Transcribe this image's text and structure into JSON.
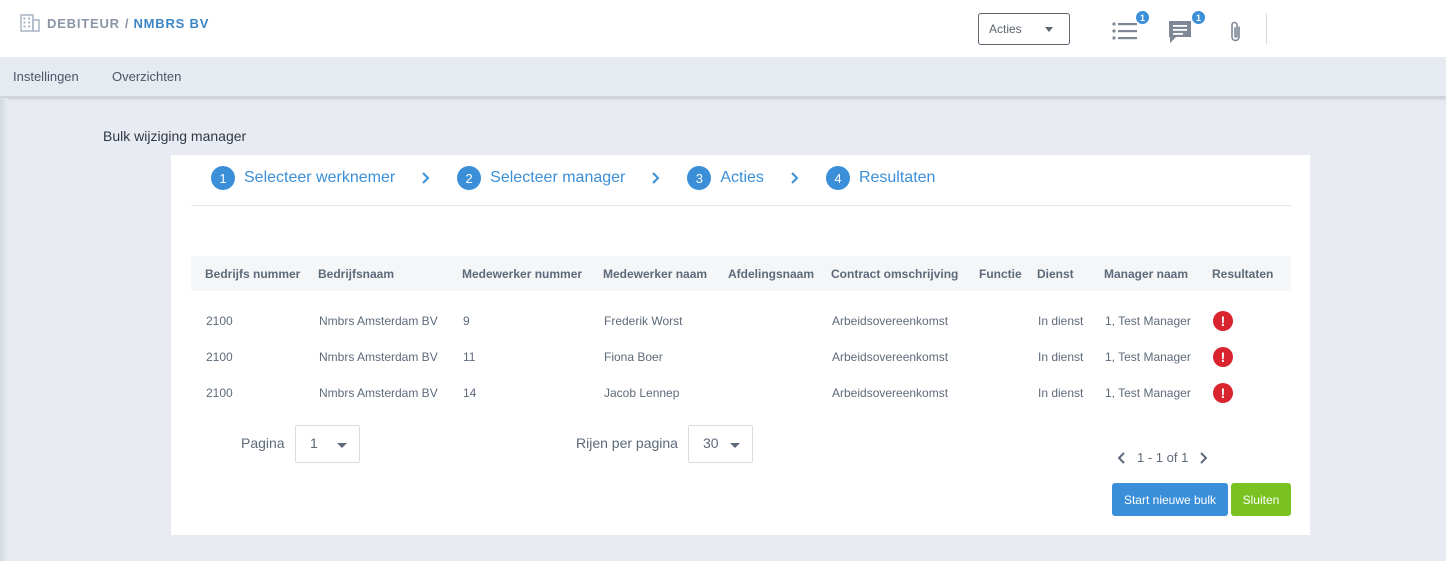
{
  "header": {
    "breadcrumb_root": "DEBITEUR",
    "breadcrumb_sep": "/",
    "breadcrumb_company": "NMBRS BV",
    "actions_dropdown": "Acties",
    "tasks_badge": "1",
    "messages_badge": "1"
  },
  "nav": {
    "items": [
      {
        "label": "Instellingen"
      },
      {
        "label": "Overzichten"
      }
    ]
  },
  "page": {
    "title": "Bulk wijziging manager"
  },
  "wizard": {
    "steps": [
      {
        "num": "1",
        "label": "Selecteer werknemer"
      },
      {
        "num": "2",
        "label": "Selecteer manager"
      },
      {
        "num": "3",
        "label": "Acties"
      },
      {
        "num": "4",
        "label": "Resultaten"
      }
    ]
  },
  "table": {
    "columns": [
      "Bedrijfs nummer",
      "Bedrijfsnaam",
      "Medewerker nummer",
      "Medewerker naam",
      "Afdelingsnaam",
      "Contract omschrijving",
      "Functie",
      "Dienst",
      "Manager naam",
      "Resultaten"
    ],
    "rows": [
      {
        "company_no": "2100",
        "company_name": "Nmbrs Amsterdam BV",
        "employee_no": "9",
        "employee_name": "Frederik Worst",
        "department": "",
        "contract": "Arbeidsovereenkomst",
        "function": "",
        "service": "In dienst",
        "manager": "1, Test Manager",
        "result": "!"
      },
      {
        "company_no": "2100",
        "company_name": "Nmbrs Amsterdam BV",
        "employee_no": "11",
        "employee_name": "Fiona Boer",
        "department": "",
        "contract": "Arbeidsovereenkomst",
        "function": "",
        "service": "In dienst",
        "manager": "1, Test Manager",
        "result": "!"
      },
      {
        "company_no": "2100",
        "company_name": "Nmbrs Amsterdam BV",
        "employee_no": "14",
        "employee_name": "Jacob Lennep",
        "department": "",
        "contract": "Arbeidsovereenkomst",
        "function": "",
        "service": "In dienst",
        "manager": "1, Test Manager",
        "result": "!"
      }
    ]
  },
  "pagination": {
    "page_label": "Pagina",
    "page_value": "1",
    "rows_label": "Rijen per pagina",
    "rows_value": "30",
    "range": "1 - 1 of 1"
  },
  "buttons": {
    "start_new": "Start nieuwe bulk",
    "close": "Sluiten"
  },
  "colors": {
    "accent": "#3a8fd8",
    "success": "#79c21f",
    "error": "#d9232e"
  },
  "icons": [
    "building-icon",
    "chevron-down-icon",
    "task-list-icon",
    "chat-icon",
    "paperclip-icon",
    "chevron-right-icon",
    "error-icon",
    "chevron-left-icon"
  ]
}
